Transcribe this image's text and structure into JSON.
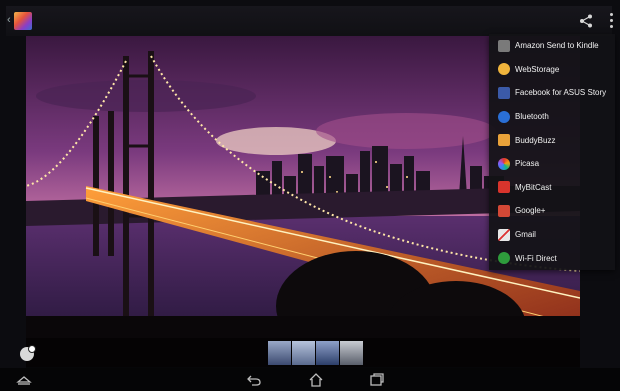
{
  "share_menu": {
    "items": [
      {
        "label": "Amazon Send to Kindle",
        "icon": "kindle-icon",
        "color": "#7a7a7a"
      },
      {
        "label": "WebStorage",
        "icon": "webstorage-icon",
        "color": "#f0b43c"
      },
      {
        "label": "Facebook for ASUS Story",
        "icon": "facebook-story-icon",
        "color": "#3b5aa8"
      },
      {
        "label": "Bluetooth",
        "icon": "bluetooth-icon",
        "color": "#2a6fd6"
      },
      {
        "label": "BuddyBuzz",
        "icon": "buddybuzz-icon",
        "color": "#e9a23a"
      },
      {
        "label": "Picasa",
        "icon": "picasa-icon",
        "color": "#c94bd1"
      },
      {
        "label": "MyBitCast",
        "icon": "mybitcast-icon",
        "color": "#d8342c"
      },
      {
        "label": "Google+",
        "icon": "google-plus-icon",
        "color": "#d34836"
      },
      {
        "label": "Gmail",
        "icon": "gmail-icon",
        "color": "#e8e8e8"
      },
      {
        "label": "Wi-Fi Direct",
        "icon": "wifi-direct-icon",
        "color": "#2e9b3c"
      }
    ]
  },
  "thumbnails": [
    {
      "icon": "photo-thumbnail",
      "color": "#6c7fae"
    },
    {
      "icon": "photo-thumbnail",
      "color": "#7d91b8"
    },
    {
      "icon": "photo-thumbnail",
      "color": "#5a74a8"
    },
    {
      "icon": "photo-thumbnail",
      "color": "#8a8f9a"
    }
  ],
  "toolbar": {
    "app_icon": "gallery-app-icon",
    "share_icon": "share-icon",
    "overflow_icon": "overflow-menu-icon"
  },
  "navigation": {
    "back": "back-icon",
    "home": "home-icon",
    "recents": "recent-apps-icon",
    "menu": "menu-icon"
  }
}
